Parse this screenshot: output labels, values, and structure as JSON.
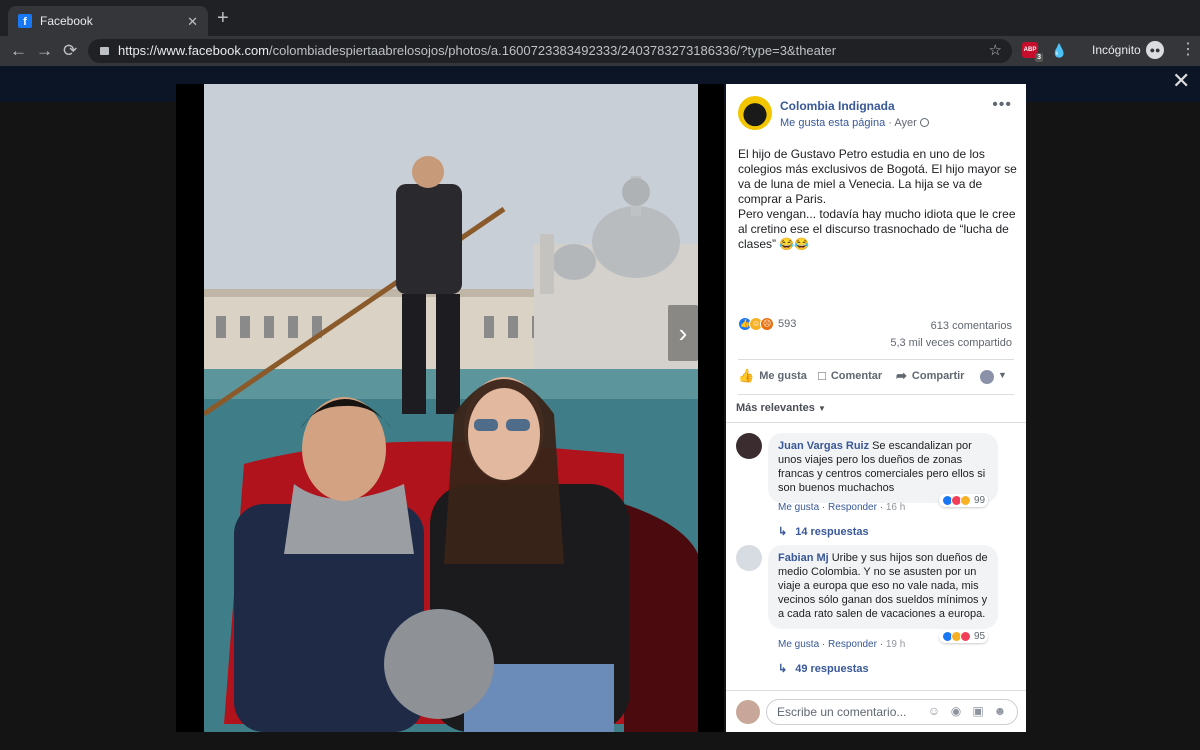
{
  "browser": {
    "tab_title": "Facebook",
    "tab_favicon": "f",
    "close_tab": "✕",
    "new_tab": "+",
    "back": "←",
    "forward": "→",
    "reload": "⟳",
    "url_host": "https://www.facebook.com",
    "url_path": "/colombiadespiertaabrelosojos/photos/a.1600723383492333/2403783273186336/?type=3&theater",
    "bookmark_star": "☆",
    "ext_abp_label": "ABP",
    "ext_abp_count": "3",
    "incognito_label": "Incógnito",
    "menu": "⋮"
  },
  "viewer": {
    "close": "✕",
    "next_arrow": "›"
  },
  "post": {
    "page_name": "Colombia Indignada",
    "like_page": "Me gusta esta página",
    "separator": "·",
    "time": "Ayer",
    "more": "•••",
    "text_lines": [
      "El hijo de Gustavo Petro estudia en uno de los colegios más exclusivos de Bogotá. El hijo mayor se va de luna de miel a Venecia. La hija se va de comprar a Paris.",
      "Pero vengan... todavía hay mucho idiota que le cree al cretino ese el discurso trasnochado de “lucha de clases” 😂😂"
    ],
    "reaction_count": "593",
    "comments_count": "613 comentarios",
    "shares_count": "5,3 mil veces compartido",
    "actions": {
      "like": "Me gusta",
      "comment": "Comentar",
      "share": "Compartir"
    },
    "relevance": "Más relevantes",
    "reaction_colors": {
      "like": "#1877f2",
      "haha": "#f7b125",
      "angry": "#e9710f",
      "love": "#f33e58"
    }
  },
  "comments": [
    {
      "author": "Juan Vargas Ruiz",
      "text": "Se escandalizan por unos viajes pero los dueños de zonas francas y centros comerciales pero ellos si son buenos muchachos",
      "reactions": "99",
      "like": "Me gusta",
      "reply": "Responder",
      "time": "16 h",
      "replies": "14 respuestas"
    },
    {
      "author": "Fabian Mj",
      "text": "Uribe y sus hijos son dueños de medio Colombia. Y no se asusten por un viaje a europa que eso no vale nada, mis vecinos sólo ganan dos sueldos mínimos y a cada rato salen de vacaciones a europa.",
      "reactions": "95",
      "like": "Me gusta",
      "reply": "Responder",
      "time": "19 h",
      "replies": "49 respuestas"
    }
  ],
  "composer": {
    "placeholder": "Escribe un comentario...",
    "icons": [
      "emoji-icon",
      "camera-icon",
      "gif-icon",
      "sticker-icon"
    ]
  }
}
